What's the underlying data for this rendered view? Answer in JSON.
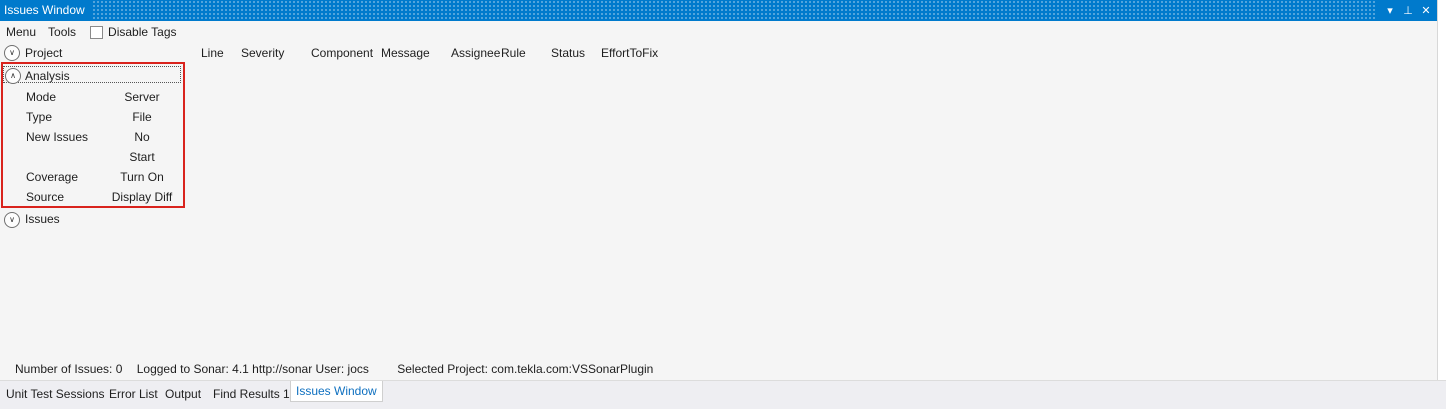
{
  "window": {
    "title": "Issues Window",
    "controls": {
      "dropdown": "▾",
      "pin": "⊥",
      "close": "✕"
    }
  },
  "menubar": {
    "menu": "Menu",
    "tools": "Tools",
    "disable_tags_label": "Disable Tags",
    "disable_tags_checked": false
  },
  "sections": {
    "project": "Project",
    "analysis": "Analysis",
    "issues": "Issues"
  },
  "columns": [
    "Line",
    "Severity",
    "Component",
    "Message",
    "Assignee",
    "Rule",
    "Status",
    "EffortToFix"
  ],
  "analysis_rows": [
    {
      "label": "Mode",
      "value": "Server"
    },
    {
      "label": "Type",
      "value": "File"
    },
    {
      "label": "New Issues",
      "value": "No"
    },
    {
      "label": "",
      "value": "Start"
    },
    {
      "label": "Coverage",
      "value": "Turn On"
    },
    {
      "label": "Source",
      "value": "Display Diff"
    }
  ],
  "status": {
    "issue_count": "Number of Issues: 0",
    "logged": "Logged to Sonar: 4.1 http://sonar User: jocs",
    "project": "Selected Project: com.tekla.com:VSSonarPlugin"
  },
  "tabs": [
    "Unit Test Sessions",
    "Error List",
    "Output",
    "Find Results 1",
    "Issues Window"
  ],
  "colors": {
    "titlebar": "#007acc",
    "highlight_border": "#d9231d",
    "active_tab_text": "#0e70c0"
  }
}
